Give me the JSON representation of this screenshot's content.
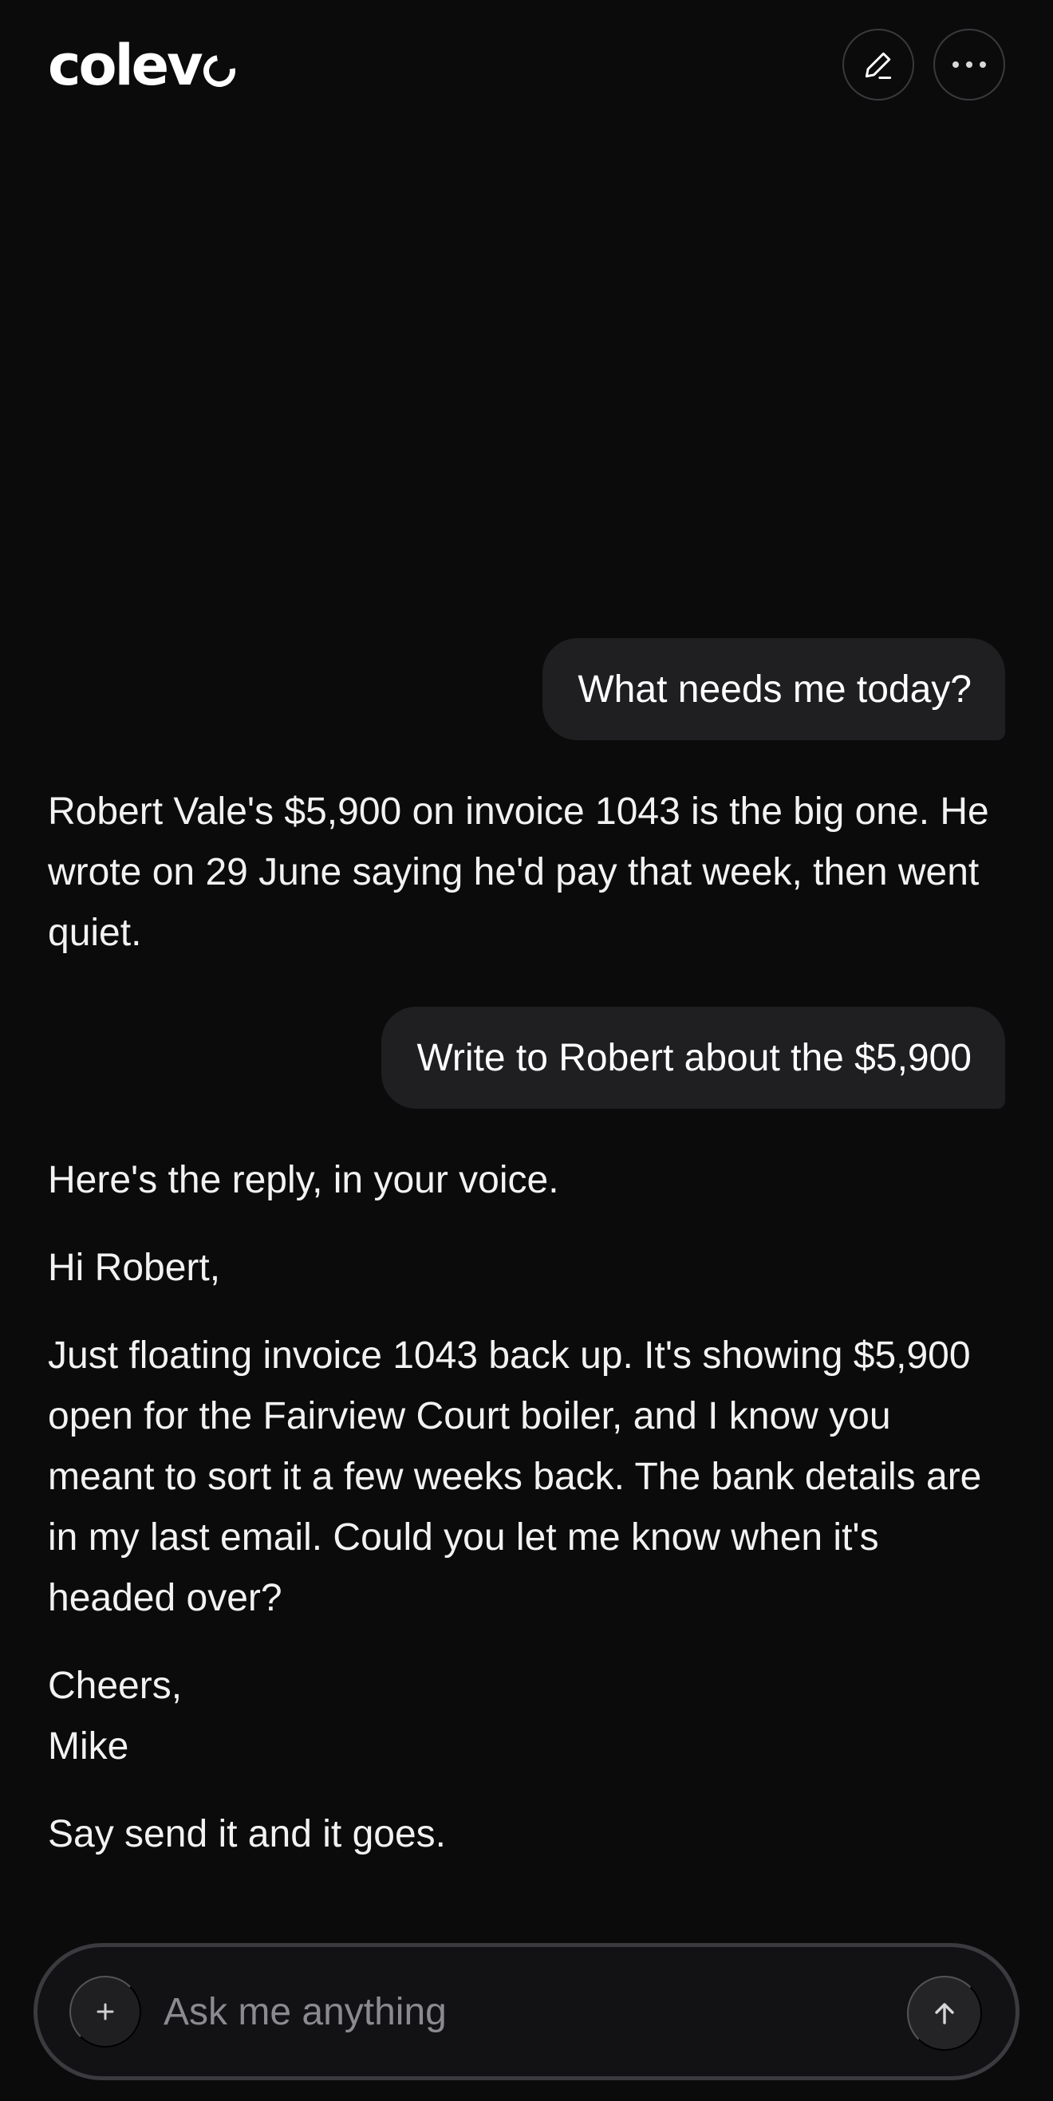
{
  "app": {
    "brand": "colev",
    "brand_icon": "ring-o-logo"
  },
  "header": {
    "compose_icon": "pencil-icon",
    "more_icon": "ellipsis-icon"
  },
  "messages": [
    {
      "role": "user",
      "text": "What needs me today?"
    },
    {
      "role": "assistant",
      "paragraphs": [
        "Robert Vale's $5,900 on invoice 1043 is the big one. He wrote on 29 June saying he'd pay that week, then went quiet."
      ]
    },
    {
      "role": "user",
      "text": "Write to Robert about the $5,900"
    },
    {
      "role": "assistant",
      "paragraphs": [
        "Here's the reply, in your voice.",
        "Hi Robert,",
        "Just floating invoice 1043 back up. It's showing $5,900 open for the Fairview Court boiler, and I know you meant to sort it a few weeks back. The bank details are in my last email. Could you let me know when it's headed over?",
        "Cheers,",
        "Mike",
        "Say send it and it goes."
      ]
    }
  ],
  "composer": {
    "placeholder": "Ask me anything",
    "value": "",
    "attach_icon": "plus-icon",
    "send_icon": "arrow-up-icon"
  },
  "colors": {
    "background": "#0b0b0c",
    "bubble": "#1f1f22",
    "text": "#f2f2f2",
    "placeholder": "#8a8a8f"
  }
}
